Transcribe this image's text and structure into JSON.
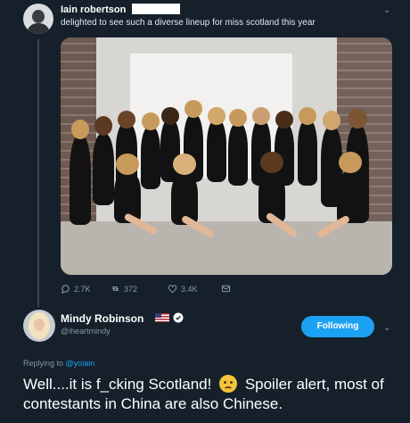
{
  "tweet1": {
    "author_name": "Iain robertson",
    "text": "delighted to see such a diverse lineup for miss scotland this year",
    "stats": {
      "replies": "2.7K",
      "retweets": "372",
      "likes": "3.4K"
    }
  },
  "tweet2": {
    "author_name": "Mindy Robinson",
    "handle": "@iheartmindy",
    "follow_label": "Following",
    "replying_prefix": "Replying to",
    "replying_to": "@yoiain",
    "text_part1": "Well....it is f_cking Scotland!",
    "emoji": "confused-face",
    "text_part2": "Spoiler alert, most of contestants in China are also Chinese."
  },
  "colors": {
    "background": "#15202b",
    "accent": "#1da1f2",
    "muted": "#8899a6",
    "text": "#ffffff"
  }
}
